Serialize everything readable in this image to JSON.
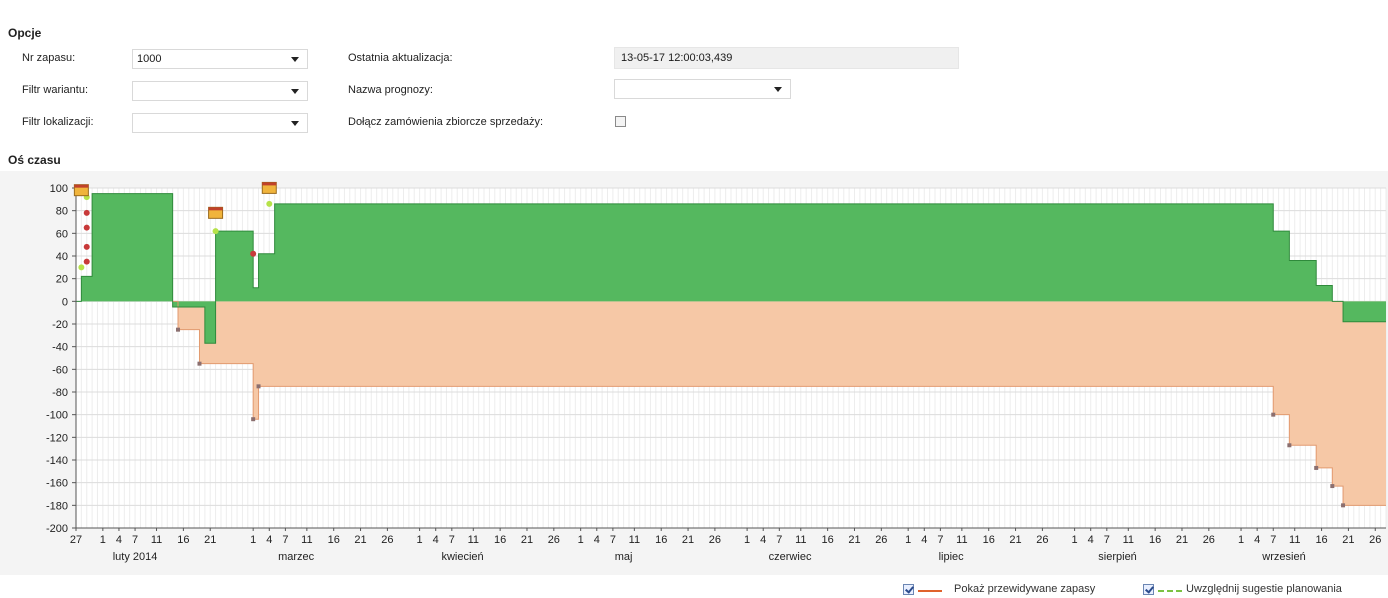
{
  "options": {
    "title": "Opcje",
    "stock_no": {
      "label": "Nr zapasu:",
      "value": "1000"
    },
    "variant_filter": {
      "label": "Filtr wariantu:",
      "value": ""
    },
    "location_filter": {
      "label": "Filtr lokalizacji:",
      "value": ""
    },
    "last_update": {
      "label": "Ostatnia aktualizacja:",
      "value": "13-05-17 12:00:03,439"
    },
    "forecast_name": {
      "label": "Nazwa prognozy:",
      "value": ""
    },
    "include_orders": {
      "label": "Dołącz zamówienia zbiorcze sprzedaży:",
      "checked": false
    }
  },
  "timeline": {
    "title": "Oś czasu"
  },
  "legend": {
    "show_projected": {
      "label": "Pokaż przewidywane zapasy",
      "checked": true,
      "color": "#e0622c"
    },
    "include_suggestions": {
      "label": "Uwzględnij sugestie planowania",
      "checked": true,
      "color": "#7cc242"
    }
  },
  "chart_data": {
    "type": "area",
    "ylim": [
      -200,
      100
    ],
    "y_ticks": [
      100,
      80,
      60,
      40,
      20,
      0,
      -20,
      -40,
      -60,
      -80,
      -100,
      -120,
      -140,
      -160,
      -180,
      -200
    ],
    "x_start": "2014-01-27",
    "x_end": "2014-09-28",
    "x_tick_labels": [
      {
        "date": "2014-01-27",
        "label": "27"
      },
      {
        "date": "2014-02-01",
        "label": "1"
      },
      {
        "date": "2014-02-04",
        "label": "4"
      },
      {
        "date": "2014-02-07",
        "label": "7"
      },
      {
        "date": "2014-02-11",
        "label": "11"
      },
      {
        "date": "2014-02-16",
        "label": "16"
      },
      {
        "date": "2014-02-21",
        "label": "21"
      },
      {
        "date": "2014-03-01",
        "label": "1"
      },
      {
        "date": "2014-03-04",
        "label": "4"
      },
      {
        "date": "2014-03-07",
        "label": "7"
      },
      {
        "date": "2014-03-11",
        "label": "11"
      },
      {
        "date": "2014-03-16",
        "label": "16"
      },
      {
        "date": "2014-03-21",
        "label": "21"
      },
      {
        "date": "2014-03-26",
        "label": "26"
      },
      {
        "date": "2014-04-01",
        "label": "1"
      },
      {
        "date": "2014-04-04",
        "label": "4"
      },
      {
        "date": "2014-04-07",
        "label": "7"
      },
      {
        "date": "2014-04-11",
        "label": "11"
      },
      {
        "date": "2014-04-16",
        "label": "16"
      },
      {
        "date": "2014-04-21",
        "label": "21"
      },
      {
        "date": "2014-04-26",
        "label": "26"
      },
      {
        "date": "2014-05-01",
        "label": "1"
      },
      {
        "date": "2014-05-04",
        "label": "4"
      },
      {
        "date": "2014-05-07",
        "label": "7"
      },
      {
        "date": "2014-05-11",
        "label": "11"
      },
      {
        "date": "2014-05-16",
        "label": "16"
      },
      {
        "date": "2014-05-21",
        "label": "21"
      },
      {
        "date": "2014-05-26",
        "label": "26"
      },
      {
        "date": "2014-06-01",
        "label": "1"
      },
      {
        "date": "2014-06-04",
        "label": "4"
      },
      {
        "date": "2014-06-07",
        "label": "7"
      },
      {
        "date": "2014-06-11",
        "label": "11"
      },
      {
        "date": "2014-06-16",
        "label": "16"
      },
      {
        "date": "2014-06-21",
        "label": "21"
      },
      {
        "date": "2014-06-26",
        "label": "26"
      },
      {
        "date": "2014-07-01",
        "label": "1"
      },
      {
        "date": "2014-07-04",
        "label": "4"
      },
      {
        "date": "2014-07-07",
        "label": "7"
      },
      {
        "date": "2014-07-11",
        "label": "11"
      },
      {
        "date": "2014-07-16",
        "label": "16"
      },
      {
        "date": "2014-07-21",
        "label": "21"
      },
      {
        "date": "2014-07-26",
        "label": "26"
      },
      {
        "date": "2014-08-01",
        "label": "1"
      },
      {
        "date": "2014-08-04",
        "label": "4"
      },
      {
        "date": "2014-08-07",
        "label": "7"
      },
      {
        "date": "2014-08-11",
        "label": "11"
      },
      {
        "date": "2014-08-16",
        "label": "16"
      },
      {
        "date": "2014-08-21",
        "label": "21"
      },
      {
        "date": "2014-08-26",
        "label": "26"
      },
      {
        "date": "2014-09-01",
        "label": "1"
      },
      {
        "date": "2014-09-04",
        "label": "4"
      },
      {
        "date": "2014-09-07",
        "label": "7"
      },
      {
        "date": "2014-09-11",
        "label": "11"
      },
      {
        "date": "2014-09-16",
        "label": "16"
      },
      {
        "date": "2014-09-21",
        "label": "21"
      },
      {
        "date": "2014-09-26",
        "label": "26"
      }
    ],
    "month_labels": [
      {
        "date": "2014-02-07",
        "label": "luty 2014"
      },
      {
        "date": "2014-03-09",
        "label": "marzec"
      },
      {
        "date": "2014-04-09",
        "label": "kwiecień"
      },
      {
        "date": "2014-05-09",
        "label": "maj"
      },
      {
        "date": "2014-06-09",
        "label": "czerwiec"
      },
      {
        "date": "2014-07-09",
        "label": "lipiec"
      },
      {
        "date": "2014-08-09",
        "label": "sierpień"
      },
      {
        "date": "2014-09-09",
        "label": "wrzesień"
      }
    ],
    "series": [
      {
        "name": "Pokaż przewidywane zapasy",
        "step": [
          {
            "x": "2014-01-27",
            "y": 0
          },
          {
            "x": "2014-01-28",
            "y": 22
          },
          {
            "x": "2014-01-30",
            "y": 95
          },
          {
            "x": "2014-02-14",
            "y": -5
          },
          {
            "x": "2014-02-20",
            "y": -37
          },
          {
            "x": "2014-02-22",
            "y": 62
          },
          {
            "x": "2014-03-01",
            "y": 12
          },
          {
            "x": "2014-03-02",
            "y": 42
          },
          {
            "x": "2014-03-05",
            "y": 86
          },
          {
            "x": "2014-09-07",
            "y": 62
          },
          {
            "x": "2014-09-10",
            "y": 36
          },
          {
            "x": "2014-09-15",
            "y": 14
          },
          {
            "x": "2014-09-18",
            "y": 0
          },
          {
            "x": "2014-09-20",
            "y": -18
          },
          {
            "x": "2014-09-28",
            "y": -18
          }
        ]
      },
      {
        "name": "Uwzględnij sugestie planowania",
        "step": [
          {
            "x": "2014-02-14",
            "y": 0
          },
          {
            "x": "2014-02-15",
            "y": -25
          },
          {
            "x": "2014-02-19",
            "y": -55
          },
          {
            "x": "2014-03-01",
            "y": -104
          },
          {
            "x": "2014-03-02",
            "y": -75
          },
          {
            "x": "2014-09-07",
            "y": -100
          },
          {
            "x": "2014-09-10",
            "y": -127
          },
          {
            "x": "2014-09-15",
            "y": -147
          },
          {
            "x": "2014-09-18",
            "y": -163
          },
          {
            "x": "2014-09-20",
            "y": -180
          },
          {
            "x": "2014-09-28",
            "y": -180
          }
        ]
      }
    ],
    "event_markers": [
      {
        "x": "2014-01-28",
        "y": 95,
        "icon": "calendar"
      },
      {
        "x": "2014-02-22",
        "y": 75,
        "icon": "calendar"
      },
      {
        "x": "2014-03-04",
        "y": 97,
        "icon": "calendar"
      }
    ],
    "red_points": [
      {
        "x": "2014-01-29",
        "y": 78
      },
      {
        "x": "2014-01-29",
        "y": 65
      },
      {
        "x": "2014-01-29",
        "y": 48
      },
      {
        "x": "2014-01-29",
        "y": 35
      },
      {
        "x": "2014-03-01",
        "y": 42
      }
    ],
    "green_points": [
      {
        "x": "2014-01-28",
        "y": 30
      },
      {
        "x": "2014-01-29",
        "y": 92
      },
      {
        "x": "2014-02-22",
        "y": 62
      },
      {
        "x": "2014-03-04",
        "y": 86
      }
    ],
    "demand_points": [
      {
        "x": "2014-02-15",
        "y": -25
      },
      {
        "x": "2014-02-19",
        "y": -55
      },
      {
        "x": "2014-03-01",
        "y": -104
      },
      {
        "x": "2014-03-02",
        "y": -75
      },
      {
        "x": "2014-09-07",
        "y": -100
      },
      {
        "x": "2014-09-10",
        "y": -127
      },
      {
        "x": "2014-09-15",
        "y": -147
      },
      {
        "x": "2014-09-18",
        "y": -163
      },
      {
        "x": "2014-09-20",
        "y": -180
      }
    ],
    "colors": {
      "supply_fill": "#55b85f",
      "supply_line": "#2f8a3b",
      "demand_fill": "#f6c8a6",
      "demand_line": "#e29a70",
      "grid": "#dcdcdc",
      "axis": "#555555",
      "point_red": "#c83a3a",
      "point_green": "#b6e24a",
      "point_gray": "#8b6f6f",
      "calendar": "#f0b43c"
    },
    "grid": true
  }
}
